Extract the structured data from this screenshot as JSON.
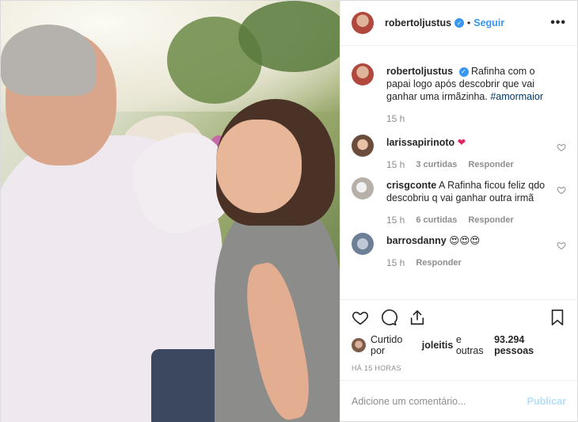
{
  "post": {
    "username": "robertoljustus",
    "follow_label": "Seguir",
    "separator": "•",
    "more_icon": "more-options-icon",
    "verified_icon": "verified-badge-icon"
  },
  "caption": {
    "username": "robertoljustus",
    "text": "Rafinha com o papai logo após descobrir que vai ganhar uma irmãzinha.",
    "hashtag": "#amormaior",
    "time": "15 h"
  },
  "comments": [
    {
      "username": "larissapirinoto",
      "text": "",
      "emoji": "❤",
      "time": "15 h",
      "likes": "3 curtidas",
      "reply": "Responder"
    },
    {
      "username": "crisgconte",
      "text": "A Rafinha ficou feliz qdo descobriu q vai ganhar outra irmã",
      "emoji": "",
      "time": "15 h",
      "likes": "6 curtidas",
      "reply": "Responder"
    },
    {
      "username": "barrosdanny",
      "text": "",
      "emoji": "😍😍😍",
      "time": "15 h",
      "likes": "",
      "reply": "Responder"
    }
  ],
  "likes": {
    "prefix": "Curtido por",
    "user": "joleitis",
    "middle": "e outras",
    "count": "93.294 pessoas"
  },
  "post_time": "HÁ 15 HORAS",
  "add_comment": {
    "placeholder": "Adicione um comentário...",
    "publish_label": "Publicar"
  },
  "colors": {
    "accent": "#3897f0",
    "publish_disabled": "#b2dffc",
    "hashtag": "#003569",
    "heart": "#e0245e"
  }
}
